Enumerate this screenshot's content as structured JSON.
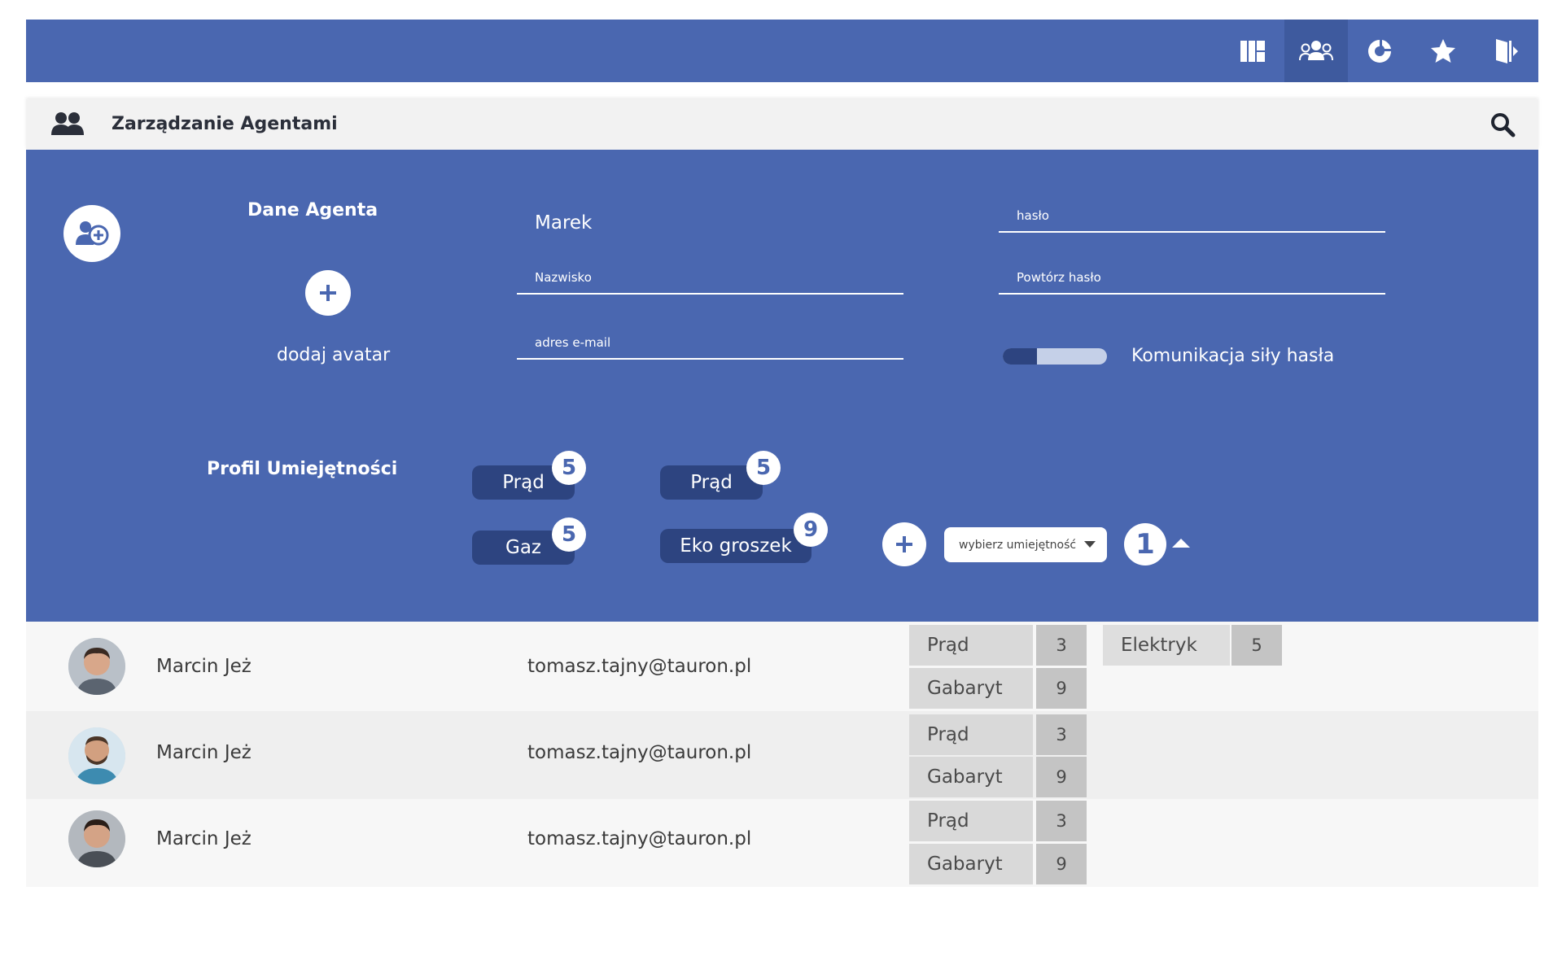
{
  "nav": {
    "icons": [
      "dashboard-icon",
      "agents-icon",
      "chart-icon",
      "star-icon",
      "logout-icon"
    ],
    "active": "agents-icon"
  },
  "header": {
    "title": "Zarządzanie Agentami"
  },
  "form": {
    "section_agent": "Dane Agenta",
    "avatar_label": "dodaj avatar",
    "first_name_value": "Marek",
    "last_name_placeholder": "Nazwisko",
    "email_placeholder": "adres e-mail",
    "password_placeholder": "hasło",
    "password_repeat_placeholder": "Powtórz hasło",
    "password_strength": 0.33,
    "password_strength_label": "Komunikacja siły hasła",
    "section_skills": "Profil Umiejętności",
    "skills": [
      {
        "label": "Prąd",
        "level": "5"
      },
      {
        "label": "Prąd",
        "level": "5"
      },
      {
        "label": "Gaz",
        "level": "5"
      },
      {
        "label": "Eko groszek",
        "level": "9"
      }
    ],
    "select_placeholder": "wybierz umiejętność",
    "skill_count": "1"
  },
  "agents": [
    {
      "name": "Marcin Jeż",
      "email": "tomasz.tajny@tauron.pl",
      "skills": [
        {
          "label": "Prąd",
          "value": "3"
        },
        {
          "label": "Gabaryt",
          "value": "9"
        },
        {
          "label": "Elektryk",
          "value": "5"
        }
      ]
    },
    {
      "name": "Marcin Jeż",
      "email": "tomasz.tajny@tauron.pl",
      "skills": [
        {
          "label": "Prąd",
          "value": "3"
        },
        {
          "label": "Gabaryt",
          "value": "9"
        }
      ]
    },
    {
      "name": "Marcin Jeż",
      "email": "tomasz.tajny@tauron.pl",
      "skills": [
        {
          "label": "Prąd",
          "value": "3"
        },
        {
          "label": "Gabaryt",
          "value": "9"
        }
      ]
    }
  ],
  "colors": {
    "primary": "#4a67b0",
    "primary_dark": "#2d4480",
    "header_bg": "#f2f2f2"
  }
}
